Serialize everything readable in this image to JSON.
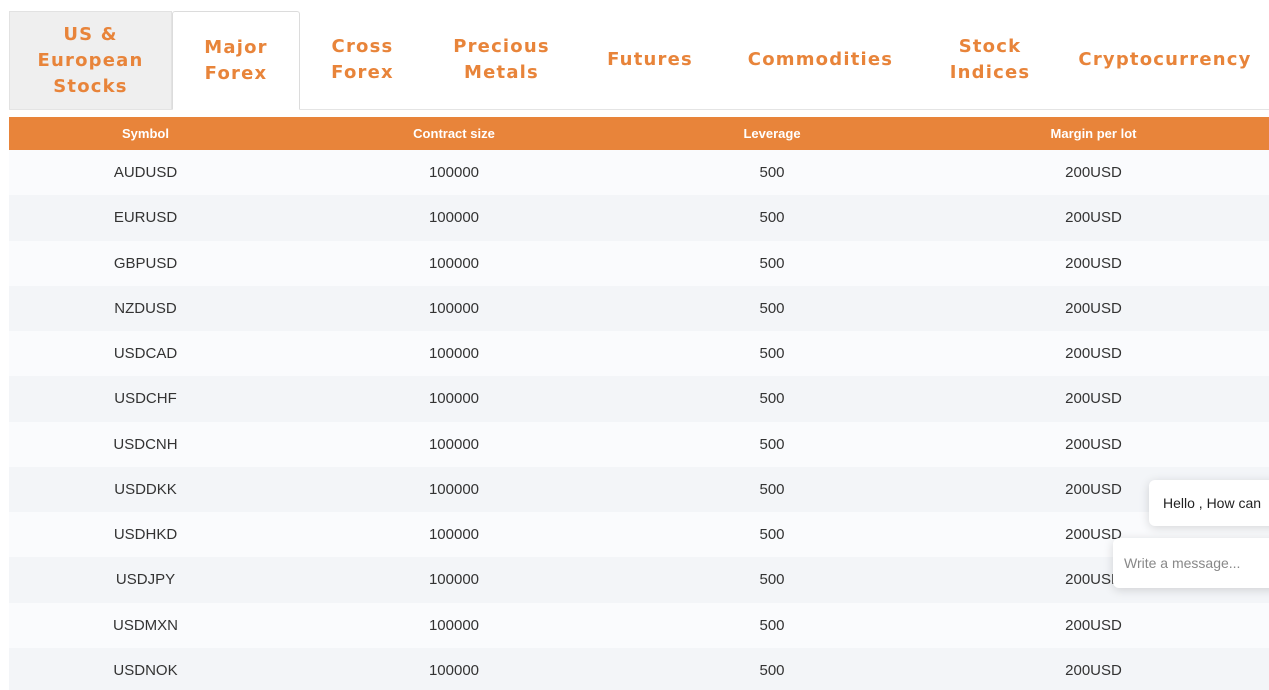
{
  "tabs": [
    {
      "label": "US &\nEuropean\nStocks",
      "state": "inactive"
    },
    {
      "label": "Major\nForex",
      "state": "active"
    },
    {
      "label": "Cross\nForex",
      "state": "inactive"
    },
    {
      "label": "Precious\nMetals",
      "state": "inactive"
    },
    {
      "label": "Futures",
      "state": "inactive"
    },
    {
      "label": "Commodities",
      "state": "inactive"
    },
    {
      "label": "Stock\nIndices",
      "state": "inactive"
    },
    {
      "label": "Cryptocurrency",
      "state": "inactive"
    }
  ],
  "table": {
    "headers": [
      "Symbol",
      "Contract size",
      "Leverage",
      "Margin per lot"
    ],
    "rows": [
      [
        "AUDUSD",
        "100000",
        "500",
        "200USD"
      ],
      [
        "EURUSD",
        "100000",
        "500",
        "200USD"
      ],
      [
        "GBPUSD",
        "100000",
        "500",
        "200USD"
      ],
      [
        "NZDUSD",
        "100000",
        "500",
        "200USD"
      ],
      [
        "USDCAD",
        "100000",
        "500",
        "200USD"
      ],
      [
        "USDCHF",
        "100000",
        "500",
        "200USD"
      ],
      [
        "USDCNH",
        "100000",
        "500",
        "200USD"
      ],
      [
        "USDDKK",
        "100000",
        "500",
        "200USD"
      ],
      [
        "USDHKD",
        "100000",
        "500",
        "200USD"
      ],
      [
        "USDJPY",
        "100000",
        "500",
        "200USD"
      ],
      [
        "USDMXN",
        "100000",
        "500",
        "200USD"
      ],
      [
        "USDNOK",
        "100000",
        "500",
        "200USD"
      ]
    ]
  },
  "chat": {
    "greeting": "Hello , How can",
    "placeholder": "Write a message..."
  },
  "colors": {
    "accent": "#e8843a",
    "header_text": "#ffffff",
    "row_odd": "#fafbfd",
    "row_even": "#f3f5f8"
  }
}
